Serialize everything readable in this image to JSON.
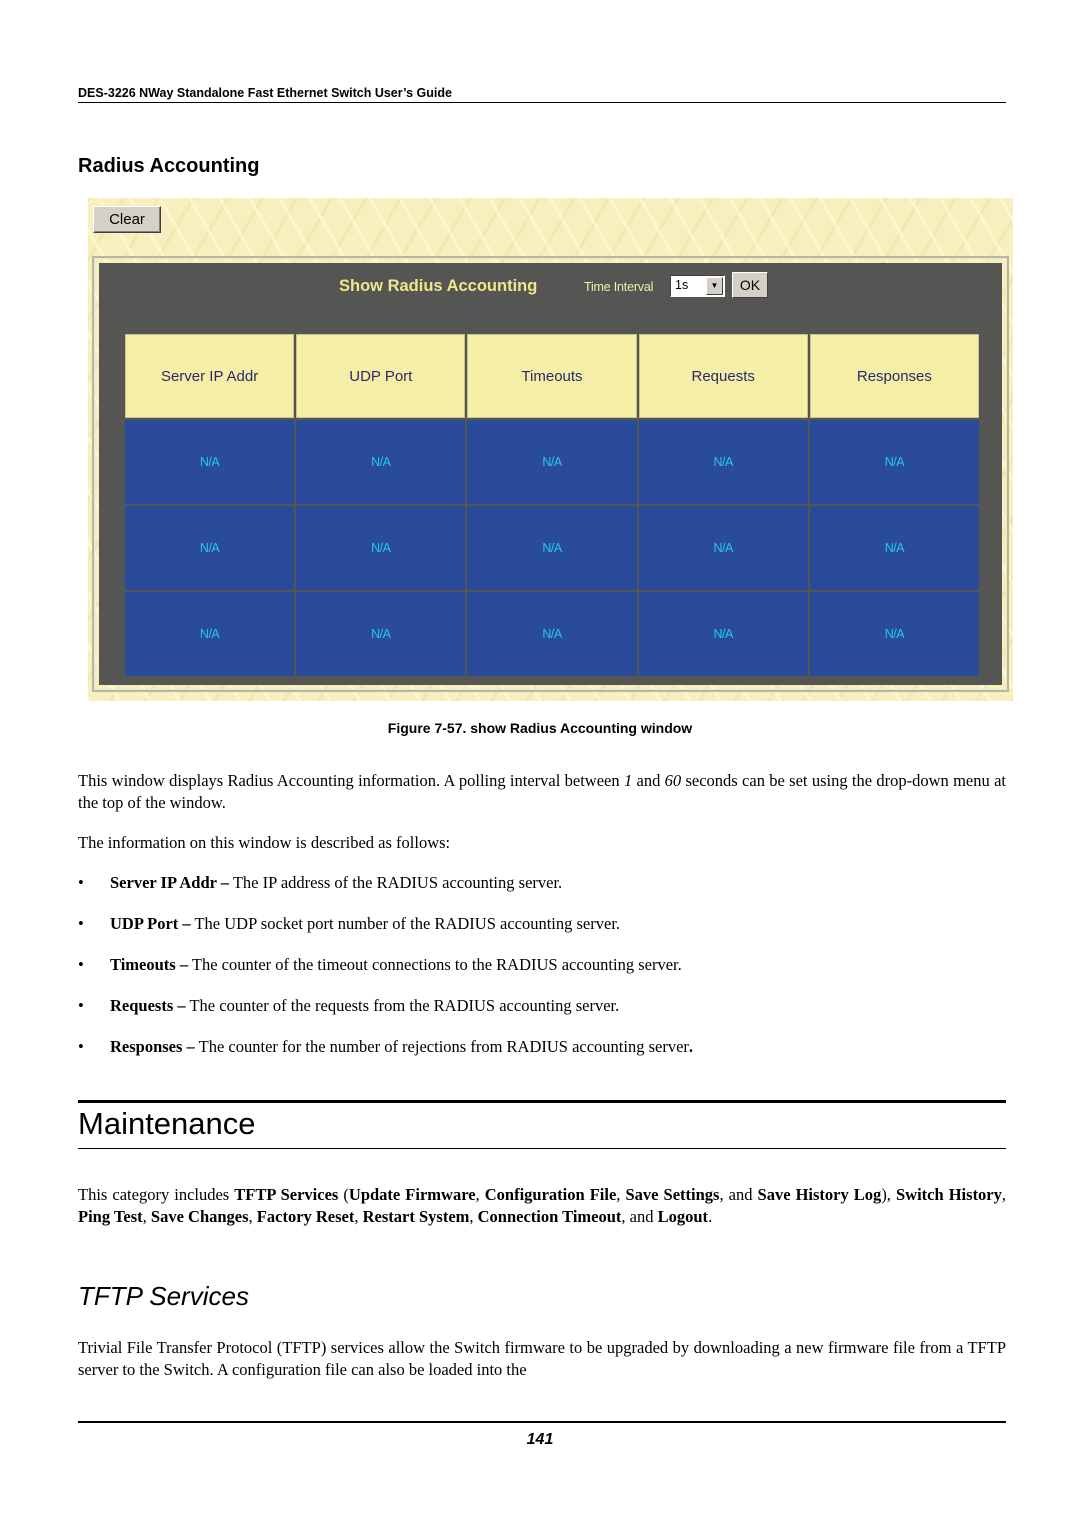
{
  "header": {
    "running_title": "DES-3226 NWay Standalone Fast Ethernet Switch User’s Guide"
  },
  "section": {
    "title": "Radius Accounting"
  },
  "figure": {
    "clear_button": "Clear",
    "panel_title": "Show Radius Accounting",
    "time_interval_label": "Time Interval",
    "time_interval_value": "1s",
    "ok_button": "OK",
    "columns": [
      "Server IP Addr",
      "UDP Port",
      "Timeouts",
      "Requests",
      "Responses"
    ],
    "rows": [
      [
        "N/A",
        "N/A",
        "N/A",
        "N/A",
        "N/A"
      ],
      [
        "N/A",
        "N/A",
        "N/A",
        "N/A",
        "N/A"
      ],
      [
        "N/A",
        "N/A",
        "N/A",
        "N/A",
        "N/A"
      ]
    ],
    "colors": {
      "header_bg": "#f5eea6",
      "cell_bg": "#2a4a9a",
      "cell_text": "#22c8f0",
      "panel_bg": "#555653",
      "title_text": "#f0e68c"
    },
    "caption": "Figure 7-57.  show Radius Accounting window"
  },
  "body": {
    "p1": {
      "a": "This window displays Radius Accounting information. A polling interval between ",
      "min": "1",
      "b": " and ",
      "max": "60",
      "c": " seconds can be set using the drop-down menu at the top of the window."
    },
    "p2": "The information on this window is described as follows:",
    "bullets": [
      {
        "term": "Server IP Addr –",
        "desc": " The IP address of the RADIUS accounting server."
      },
      {
        "term": "UDP Port –",
        "desc": " The UDP socket port number of the RADIUS accounting server."
      },
      {
        "term": "Timeouts –",
        "desc": " The counter of the timeout connections to the RADIUS accounting server."
      },
      {
        "term": "Requests –",
        "desc": " The counter of the requests from the RADIUS accounting server."
      },
      {
        "term": "Responses –",
        "desc": " The counter for the number of rejections from RADIUS accounting server",
        "end": "."
      }
    ]
  },
  "maintenance": {
    "title": "Maintenance",
    "intro": [
      {
        "t": "This category includes ",
        "b": false
      },
      {
        "t": "TFTP Services",
        "b": true
      },
      {
        "t": " (",
        "b": false
      },
      {
        "t": "Update Firmware",
        "b": true
      },
      {
        "t": ", ",
        "b": false
      },
      {
        "t": "Configuration File",
        "b": true
      },
      {
        "t": ", ",
        "b": false
      },
      {
        "t": "Save Settings",
        "b": true
      },
      {
        "t": ", and ",
        "b": false
      },
      {
        "t": "Save History Log",
        "b": true
      },
      {
        "t": "), ",
        "b": false
      },
      {
        "t": "Switch History",
        "b": true
      },
      {
        "t": ", ",
        "b": false
      },
      {
        "t": "Ping Test",
        "b": true
      },
      {
        "t": ", ",
        "b": false
      },
      {
        "t": "Save Changes",
        "b": true
      },
      {
        "t": ", ",
        "b": false
      },
      {
        "t": "Factory Reset",
        "b": true
      },
      {
        "t": ", ",
        "b": false
      },
      {
        "t": "Restart System",
        "b": true
      },
      {
        "t": ", ",
        "b": false
      },
      {
        "t": "Connection Timeout",
        "b": true
      },
      {
        "t": ", and ",
        "b": false
      },
      {
        "t": "Logout",
        "b": true
      },
      {
        "t": ".",
        "b": false
      }
    ]
  },
  "tftp": {
    "title": "TFTP Services",
    "text": "Trivial File Transfer Protocol (TFTP) services allow the Switch firmware to be upgraded by downloading a new firmware file from a TFTP server to the Switch. A configuration file can also be loaded into the"
  },
  "footer": {
    "page_number": "141"
  }
}
